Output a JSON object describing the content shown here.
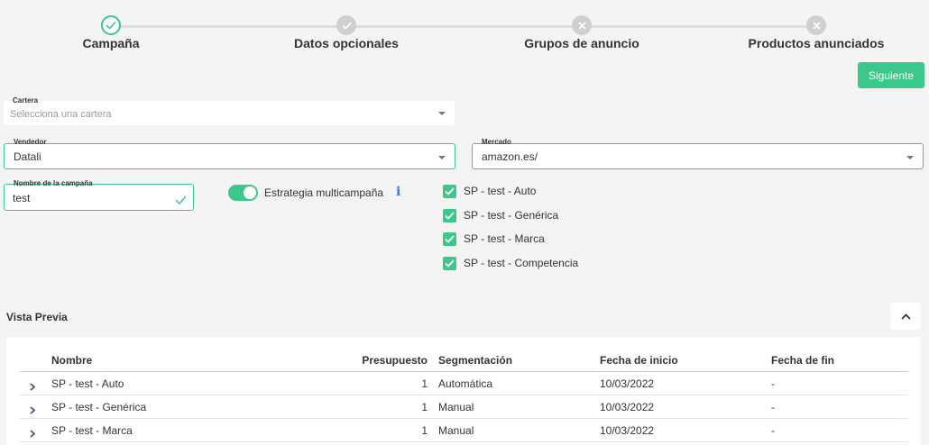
{
  "stepper": {
    "steps": [
      {
        "label": "Campaña",
        "status": "completed"
      },
      {
        "label": "Datos opcionales",
        "status": "done"
      },
      {
        "label": "Grupos de anuncio",
        "status": "pending"
      },
      {
        "label": "Productos anunciados",
        "status": "pending"
      }
    ],
    "next_label": "Siguiente"
  },
  "form": {
    "cartera": {
      "label": "Cartera",
      "placeholder": "Selecciona una cartera",
      "value": ""
    },
    "vendedor": {
      "label": "Vendedor",
      "value": "Datali"
    },
    "mercado": {
      "label": "Mercado",
      "value": "amazon.es/"
    },
    "nombre": {
      "label": "Nombre de la campaña",
      "value": "test"
    },
    "estrategia": {
      "label": "Estrategia multicampaña",
      "enabled": true,
      "info_icon": "i"
    },
    "campaigns": [
      {
        "label": "SP - test - Auto",
        "checked": true
      },
      {
        "label": "SP - test - Genérica",
        "checked": true
      },
      {
        "label": "SP - test - Marca",
        "checked": true
      },
      {
        "label": "SP - test - Competencia",
        "checked": true
      }
    ]
  },
  "preview": {
    "title": "Vista Previa",
    "columns": [
      "Nombre",
      "Presupuesto",
      "Segmentación",
      "Fecha de inicio",
      "Fecha de fin"
    ],
    "rows": [
      {
        "nombre": "SP - test - Auto",
        "presupuesto": "1",
        "segmentacion": "Automática",
        "inicio": "10/03/2022",
        "fin": "-"
      },
      {
        "nombre": "SP - test - Genérica",
        "presupuesto": "1",
        "segmentacion": "Manual",
        "inicio": "10/03/2022",
        "fin": "-"
      },
      {
        "nombre": "SP - test - Marca",
        "presupuesto": "1",
        "segmentacion": "Manual",
        "inicio": "10/03/2022",
        "fin": "-"
      }
    ]
  },
  "colors": {
    "accent": "#3cc88a",
    "info": "#3a7bd5",
    "pending": "#cfcfcf"
  }
}
